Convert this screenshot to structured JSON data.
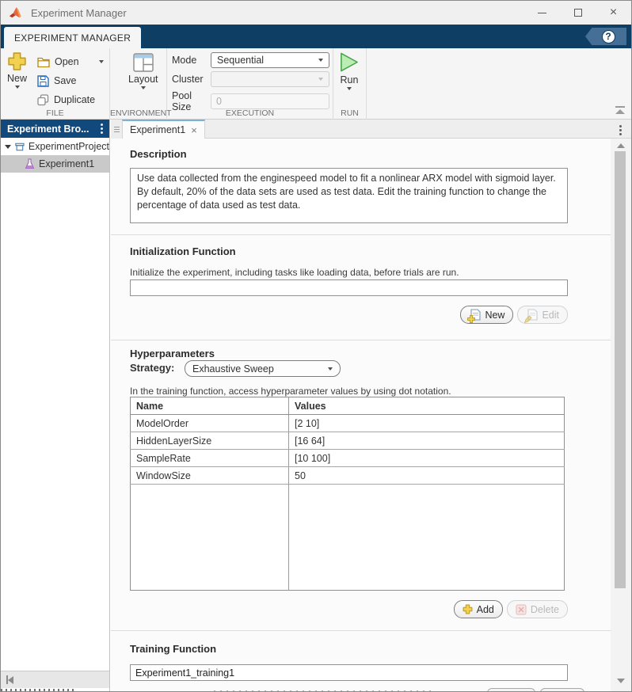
{
  "window": {
    "title": "Experiment Manager"
  },
  "ribbon": {
    "tab_label": "EXPERIMENT MANAGER",
    "help_glyph": "?"
  },
  "toolbar": {
    "file": {
      "section": "FILE",
      "new_label": "New",
      "open_label": "Open",
      "save_label": "Save",
      "duplicate_label": "Duplicate"
    },
    "environment": {
      "section": "ENVIRONMENT",
      "layout_label": "Layout"
    },
    "execution": {
      "section": "EXECUTION",
      "mode_label": "Mode",
      "mode_value": "Sequential",
      "cluster_label": "Cluster",
      "pool_label": "Pool Size",
      "pool_value": "0"
    },
    "run": {
      "section": "RUN",
      "run_label": "Run"
    }
  },
  "browser": {
    "title": "Experiment Bro...",
    "project_label": "ExperimentProject",
    "experiment_label": "Experiment1"
  },
  "doc": {
    "tab_label": "Experiment1",
    "tab_close": "×",
    "description": {
      "heading": "Description",
      "text": "Use data collected from the enginespeed model to fit a nonlinear ARX model with sigmoid layer. By default, 20% of the data sets are used as test data. Edit the training function to change the percentage of data used as test data."
    },
    "init": {
      "heading": "Initialization Function",
      "hint": "Initialize the experiment, including tasks like loading data, before trials are run.",
      "value": "",
      "new_label": "New",
      "edit_label": "Edit"
    },
    "hyper": {
      "heading": "Hyperparameters",
      "strategy_label": "Strategy:",
      "strategy_value": "Exhaustive Sweep",
      "hint": "In the training function, access hyperparameter values by using dot notation.",
      "columns": [
        "Name",
        "Values"
      ],
      "rows": [
        [
          "ModelOrder",
          "[2 10]"
        ],
        [
          "HiddenLayerSize",
          "[16 64]"
        ],
        [
          "SampleRate",
          "[10 100]"
        ],
        [
          "WindowSize",
          "50"
        ]
      ],
      "add_label": "Add",
      "delete_label": "Delete"
    },
    "training": {
      "heading": "Training Function",
      "value": "Experiment1_training1"
    }
  }
}
